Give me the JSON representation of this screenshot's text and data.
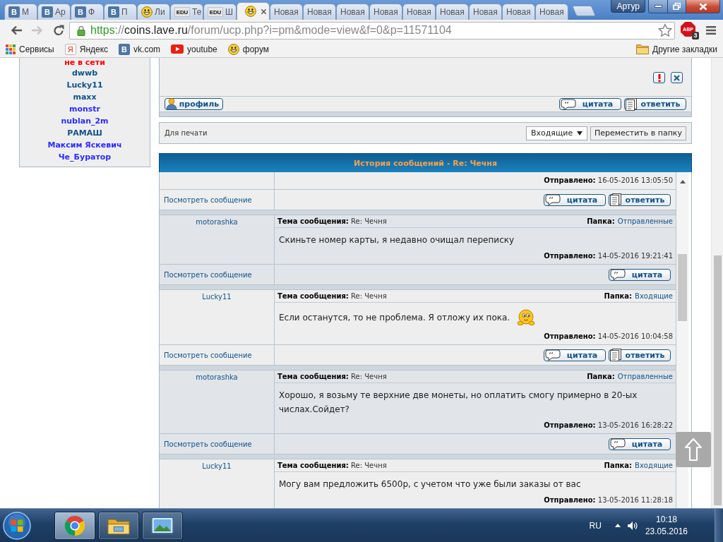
{
  "browser": {
    "tabs": [
      {
        "kind": "vk",
        "icon_text": "В",
        "label": "М",
        "selected": false
      },
      {
        "kind": "vk",
        "icon_text": "В",
        "label": "Ар",
        "selected": false
      },
      {
        "kind": "vk",
        "icon_text": "В",
        "label": "Ф",
        "selected": false
      },
      {
        "kind": "vk",
        "icon_text": "В",
        "label": "П",
        "selected": false
      },
      {
        "kind": "smiley",
        "label": "Ли",
        "selected": false
      },
      {
        "kind": "edu",
        "icon_text": "EDU",
        "label": "Те",
        "selected": false
      },
      {
        "kind": "edu",
        "icon_text": "EDU",
        "label": "Ш",
        "selected": false
      },
      {
        "kind": "smiley",
        "selected": true
      },
      {
        "kind": "blank",
        "label": "Новая",
        "selected": false
      },
      {
        "kind": "blank",
        "label": "Новая",
        "selected": false
      },
      {
        "kind": "blank",
        "label": "Новая",
        "selected": false
      },
      {
        "kind": "blank",
        "label": "Новая",
        "selected": false
      },
      {
        "kind": "blank",
        "label": "Новая",
        "selected": false
      },
      {
        "kind": "blank",
        "label": "Новая",
        "selected": false
      },
      {
        "kind": "blank",
        "label": "Новая",
        "selected": false
      },
      {
        "kind": "blank",
        "label": "Новая",
        "selected": false
      },
      {
        "kind": "blank",
        "label": "Новая",
        "selected": false
      }
    ],
    "profile": "Артур",
    "nav": {
      "back": {
        "disabled": false
      },
      "forward": {
        "disabled": true
      }
    },
    "address": {
      "scheme": "https",
      "separator": "://",
      "host": "coins.lave.ru",
      "path": "/forum/ucp.php?i=pm&mode=view&f=0&p=11571104"
    },
    "extension": {
      "label": "ABP",
      "badge": "3"
    },
    "bookmarks": [
      {
        "kind": "apps",
        "label": "Сервисы"
      },
      {
        "kind": "yandex",
        "icon_text": "Я",
        "label": "Яндекс"
      },
      {
        "kind": "vk",
        "icon_text": "В",
        "label": "vk.com"
      },
      {
        "kind": "youtube",
        "label": "youtube"
      },
      {
        "kind": "smiley",
        "label": "форум"
      }
    ],
    "other_bookmarks": "Другие закладки"
  },
  "sidebar": {
    "heading": "не в сети",
    "users": [
      {
        "name": "dwwb",
        "color": "#105289"
      },
      {
        "name": "Lucky11",
        "color": "#105289"
      },
      {
        "name": "maxx",
        "color": "#105289"
      },
      {
        "name": "monstr",
        "color": "#2b2bff"
      },
      {
        "name": "nublan_2m",
        "color": "#2b2bff"
      },
      {
        "name": "РАМАШ",
        "color": "#105289"
      },
      {
        "name": "Максим Яскевич",
        "color": "#2b2bff"
      },
      {
        "name": "Че_Буратор",
        "color": "#2b2bff"
      }
    ]
  },
  "message_panel": {
    "profile_button": "профиль",
    "actions": [
      {
        "kind": "quote",
        "label": "цитата"
      },
      {
        "kind": "reply",
        "label": "ответить"
      }
    ]
  },
  "toolbar": {
    "print_link": "Для печати",
    "folder_select": "Входящие",
    "move_button": "Переместить в папку"
  },
  "history": {
    "title": "История сообщений - Re: Чечня",
    "messages": [
      {
        "sent": "**Отправлено:** 16-05-2016 13:05:50",
        "view_link": "Посмотреть сообщение",
        "actions": [
          {
            "kind": "quote",
            "label": "цитата"
          },
          {
            "kind": "reply",
            "label": "ответить"
          }
        ]
      },
      {
        "author": "motorashka",
        "subject": "**Тема сообщения:** Re: Чечня",
        "folder_label": "Папка:",
        "folder": "Отправленные",
        "body": "Скиньте номер карты, я недавно очищал переписку",
        "sent": "**Отправлено:** 14-05-2016 19:21:41",
        "view_link": "Посмотреть сообщение",
        "actions": [
          {
            "kind": "quote",
            "label": "цитата"
          }
        ]
      },
      {
        "author": "Lucky11",
        "subject": "**Тема сообщения:** Re: Чечня",
        "folder_label": "Папка:",
        "folder": "Входящие",
        "body": "Если останутся, то не проблема. Я отложу их пока.",
        "emoticon": true,
        "sent": "**Отправлено:** 14-05-2016 10:04:58",
        "view_link": "Посмотреть сообщение",
        "actions": [
          {
            "kind": "quote",
            "label": "цитата"
          },
          {
            "kind": "reply",
            "label": "ответить"
          }
        ]
      },
      {
        "author": "motorashka",
        "subject": "**Тема сообщения:** Re: Чечня",
        "folder_label": "Папка:",
        "folder": "Отправленные",
        "body": "Хорошо, я возьму те верхние две монеты, но оплатить смогу примерно в 20-ых числах.Сойдет?",
        "sent": "**Отправлено:** 13-05-2016 16:28:22",
        "view_link": "Посмотреть сообщение",
        "actions": [
          {
            "kind": "quote",
            "label": "цитата"
          }
        ]
      },
      {
        "author": "Lucky11",
        "subject": "**Тема сообщения:** Re: Чечня",
        "folder_label": "Папка:",
        "folder": "Входящие",
        "body": "Могу вам предложить 6500р, с учетом что уже были заказы от вас",
        "sent": "**Отправлено:** 13-05-2016 11:28:18"
      }
    ]
  },
  "taskbar": {
    "apps": [
      {
        "kind": "chrome",
        "selected": true
      },
      {
        "kind": "explorer",
        "selected": false
      },
      {
        "kind": "photos",
        "selected": false
      }
    ],
    "language": "RU",
    "time": "10:18",
    "date": "23.05.2016"
  }
}
